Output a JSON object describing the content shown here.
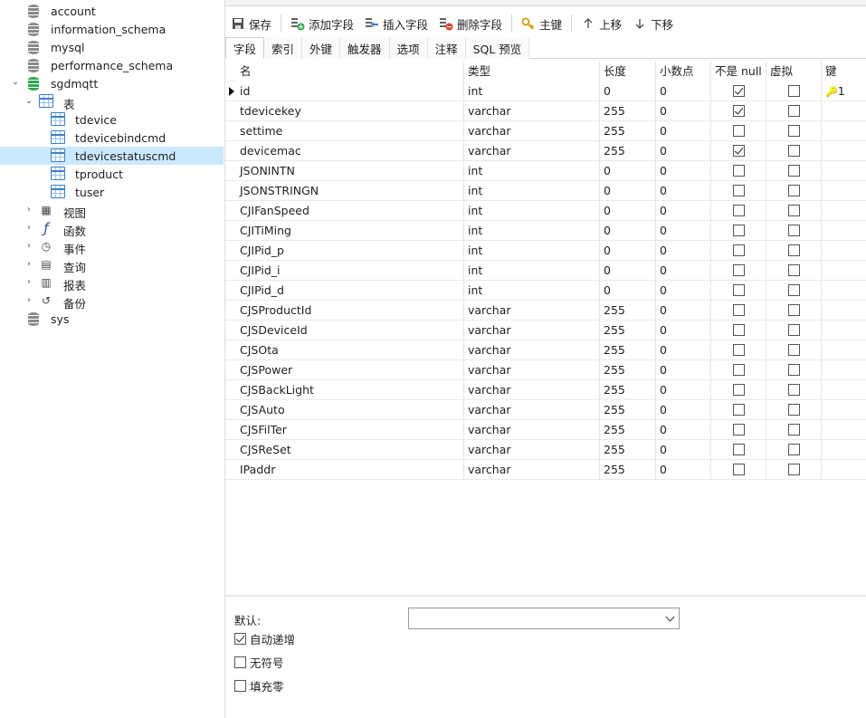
{
  "tree": {
    "items": [
      {
        "label": "account",
        "icon": "database-icon",
        "level": 0
      },
      {
        "label": "information_schema",
        "icon": "database-icon",
        "level": 0
      },
      {
        "label": "mysql",
        "icon": "database-icon",
        "level": 0
      },
      {
        "label": "performance_schema",
        "icon": "database-icon",
        "level": 0
      },
      {
        "label": "sgdmqtt",
        "icon": "database-open-icon",
        "level": 0,
        "expanded": true
      },
      {
        "label": "表",
        "icon": "tables-folder-icon",
        "level": 1,
        "expanded": true
      },
      {
        "label": "tdevice",
        "icon": "table-icon",
        "level": 2
      },
      {
        "label": "tdevicebindcmd",
        "icon": "table-icon",
        "level": 2
      },
      {
        "label": "tdevicestatuscmd",
        "icon": "table-icon",
        "level": 2,
        "selected": true
      },
      {
        "label": "tproduct",
        "icon": "table-icon",
        "level": 2
      },
      {
        "label": "tuser",
        "icon": "table-icon",
        "level": 2
      },
      {
        "label": "视图",
        "icon": "views-icon",
        "level": 1
      },
      {
        "label": "函数",
        "icon": "function-icon",
        "level": 1
      },
      {
        "label": "事件",
        "icon": "clock-icon",
        "level": 1
      },
      {
        "label": "查询",
        "icon": "query-icon",
        "level": 1
      },
      {
        "label": "报表",
        "icon": "report-icon",
        "level": 1
      },
      {
        "label": "备份",
        "icon": "backup-icon",
        "level": 1
      },
      {
        "label": "sys",
        "icon": "database-icon",
        "level": 0
      }
    ]
  },
  "toolbar": {
    "save": "保存",
    "add_field": "添加字段",
    "insert_field": "插入字段",
    "delete_field": "删除字段",
    "primary_key": "主键",
    "move_up": "上移",
    "move_down": "下移"
  },
  "subtabs": [
    "字段",
    "索引",
    "外键",
    "触发器",
    "选项",
    "注释",
    "SQL 预览"
  ],
  "grid": {
    "headers": {
      "name": "名",
      "type": "类型",
      "length": "长度",
      "decimals": "小数点",
      "not_null": "不是 null",
      "virtual": "虚拟",
      "key": "键"
    },
    "rows": [
      {
        "name": "id",
        "type": "int",
        "length": "0",
        "decimals": "0",
        "not_null": true,
        "virtual": false,
        "key": "1"
      },
      {
        "name": "tdevicekey",
        "type": "varchar",
        "length": "255",
        "decimals": "0",
        "not_null": true,
        "virtual": false,
        "key": ""
      },
      {
        "name": "settime",
        "type": "varchar",
        "length": "255",
        "decimals": "0",
        "not_null": false,
        "virtual": false,
        "key": ""
      },
      {
        "name": "devicemac",
        "type": "varchar",
        "length": "255",
        "decimals": "0",
        "not_null": true,
        "virtual": false,
        "key": ""
      },
      {
        "name": "JSONINTN",
        "type": "int",
        "length": "0",
        "decimals": "0",
        "not_null": false,
        "virtual": false,
        "key": ""
      },
      {
        "name": "JSONSTRINGN",
        "type": "int",
        "length": "0",
        "decimals": "0",
        "not_null": false,
        "virtual": false,
        "key": ""
      },
      {
        "name": "CJIFanSpeed",
        "type": "int",
        "length": "0",
        "decimals": "0",
        "not_null": false,
        "virtual": false,
        "key": ""
      },
      {
        "name": "CJITiMing",
        "type": "int",
        "length": "0",
        "decimals": "0",
        "not_null": false,
        "virtual": false,
        "key": ""
      },
      {
        "name": "CJIPid_p",
        "type": "int",
        "length": "0",
        "decimals": "0",
        "not_null": false,
        "virtual": false,
        "key": ""
      },
      {
        "name": "CJIPid_i",
        "type": "int",
        "length": "0",
        "decimals": "0",
        "not_null": false,
        "virtual": false,
        "key": ""
      },
      {
        "name": "CJIPid_d",
        "type": "int",
        "length": "0",
        "decimals": "0",
        "not_null": false,
        "virtual": false,
        "key": ""
      },
      {
        "name": "CJSProductId",
        "type": "varchar",
        "length": "255",
        "decimals": "0",
        "not_null": false,
        "virtual": false,
        "key": ""
      },
      {
        "name": "CJSDeviceId",
        "type": "varchar",
        "length": "255",
        "decimals": "0",
        "not_null": false,
        "virtual": false,
        "key": ""
      },
      {
        "name": "CJSOta",
        "type": "varchar",
        "length": "255",
        "decimals": "0",
        "not_null": false,
        "virtual": false,
        "key": ""
      },
      {
        "name": "CJSPower",
        "type": "varchar",
        "length": "255",
        "decimals": "0",
        "not_null": false,
        "virtual": false,
        "key": ""
      },
      {
        "name": "CJSBackLight",
        "type": "varchar",
        "length": "255",
        "decimals": "0",
        "not_null": false,
        "virtual": false,
        "key": ""
      },
      {
        "name": "CJSAuto",
        "type": "varchar",
        "length": "255",
        "decimals": "0",
        "not_null": false,
        "virtual": false,
        "key": ""
      },
      {
        "name": "CJSFilTer",
        "type": "varchar",
        "length": "255",
        "decimals": "0",
        "not_null": false,
        "virtual": false,
        "key": ""
      },
      {
        "name": "CJSReSet",
        "type": "varchar",
        "length": "255",
        "decimals": "0",
        "not_null": false,
        "virtual": false,
        "key": ""
      },
      {
        "name": "IPaddr",
        "type": "varchar",
        "length": "255",
        "decimals": "0",
        "not_null": false,
        "virtual": false,
        "key": ""
      }
    ]
  },
  "bottom": {
    "default_label": "默认:",
    "default_value": "",
    "auto_increment": {
      "label": "自动递增",
      "checked": true
    },
    "unsigned": {
      "label": "无符号",
      "checked": false
    },
    "zerofill": {
      "label": "填充零",
      "checked": false
    }
  },
  "colors": {
    "selection": "#cce8ff",
    "key": "#d7a21a",
    "db_open": "#2ea84a",
    "table": "#3a7fc9"
  }
}
